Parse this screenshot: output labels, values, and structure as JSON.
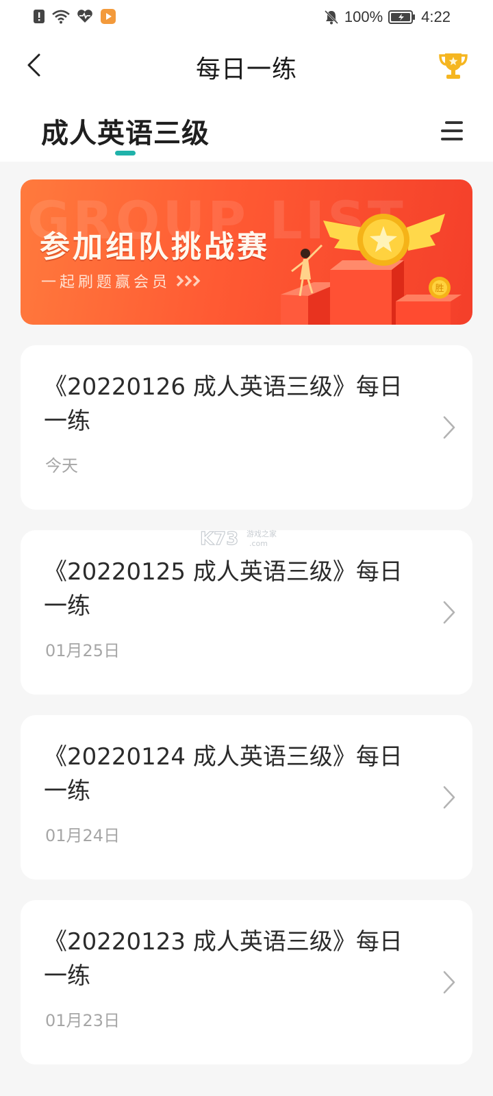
{
  "status": {
    "battery_text": "100%",
    "time": "4:22"
  },
  "nav": {
    "title": "每日一练",
    "back_icon": "chevron-left-icon",
    "trophy_icon": "trophy-icon"
  },
  "tabs": {
    "active_label": "成人英语三级",
    "menu_icon": "menu-icon",
    "accent_color": "#20b2aa"
  },
  "banner": {
    "title": "参加组队挑战赛",
    "subtitle": "一起刷题赢会员",
    "watermark_text": "GROUP LIST",
    "badge_text": "胜",
    "gradient": [
      "#ff7a3d",
      "#f43f2a"
    ]
  },
  "watermark": {
    "brand": "K73",
    "suffix": "游戏之家",
    "domain": ".com"
  },
  "practice_list": [
    {
      "title": "《20220126 成人英语三级》每日一练",
      "date": "今天"
    },
    {
      "title": "《20220125 成人英语三级》每日一练",
      "date": "01月25日"
    },
    {
      "title": "《20220124 成人英语三级》每日一练",
      "date": "01月24日"
    },
    {
      "title": "《20220123 成人英语三级》每日一练",
      "date": "01月23日"
    }
  ]
}
